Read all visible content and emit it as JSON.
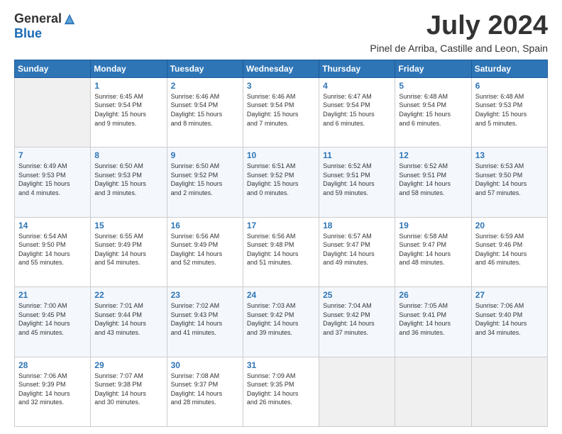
{
  "header": {
    "logo_general": "General",
    "logo_blue": "Blue",
    "month_title": "July 2024",
    "location": "Pinel de Arriba, Castille and Leon, Spain"
  },
  "calendar": {
    "days_of_week": [
      "Sunday",
      "Monday",
      "Tuesday",
      "Wednesday",
      "Thursday",
      "Friday",
      "Saturday"
    ],
    "weeks": [
      [
        {
          "day": "",
          "info": ""
        },
        {
          "day": "1",
          "info": "Sunrise: 6:45 AM\nSunset: 9:54 PM\nDaylight: 15 hours\nand 9 minutes."
        },
        {
          "day": "2",
          "info": "Sunrise: 6:46 AM\nSunset: 9:54 PM\nDaylight: 15 hours\nand 8 minutes."
        },
        {
          "day": "3",
          "info": "Sunrise: 6:46 AM\nSunset: 9:54 PM\nDaylight: 15 hours\nand 7 minutes."
        },
        {
          "day": "4",
          "info": "Sunrise: 6:47 AM\nSunset: 9:54 PM\nDaylight: 15 hours\nand 6 minutes."
        },
        {
          "day": "5",
          "info": "Sunrise: 6:48 AM\nSunset: 9:54 PM\nDaylight: 15 hours\nand 6 minutes."
        },
        {
          "day": "6",
          "info": "Sunrise: 6:48 AM\nSunset: 9:53 PM\nDaylight: 15 hours\nand 5 minutes."
        }
      ],
      [
        {
          "day": "7",
          "info": "Sunrise: 6:49 AM\nSunset: 9:53 PM\nDaylight: 15 hours\nand 4 minutes."
        },
        {
          "day": "8",
          "info": "Sunrise: 6:50 AM\nSunset: 9:53 PM\nDaylight: 15 hours\nand 3 minutes."
        },
        {
          "day": "9",
          "info": "Sunrise: 6:50 AM\nSunset: 9:52 PM\nDaylight: 15 hours\nand 2 minutes."
        },
        {
          "day": "10",
          "info": "Sunrise: 6:51 AM\nSunset: 9:52 PM\nDaylight: 15 hours\nand 0 minutes."
        },
        {
          "day": "11",
          "info": "Sunrise: 6:52 AM\nSunset: 9:51 PM\nDaylight: 14 hours\nand 59 minutes."
        },
        {
          "day": "12",
          "info": "Sunrise: 6:52 AM\nSunset: 9:51 PM\nDaylight: 14 hours\nand 58 minutes."
        },
        {
          "day": "13",
          "info": "Sunrise: 6:53 AM\nSunset: 9:50 PM\nDaylight: 14 hours\nand 57 minutes."
        }
      ],
      [
        {
          "day": "14",
          "info": "Sunrise: 6:54 AM\nSunset: 9:50 PM\nDaylight: 14 hours\nand 55 minutes."
        },
        {
          "day": "15",
          "info": "Sunrise: 6:55 AM\nSunset: 9:49 PM\nDaylight: 14 hours\nand 54 minutes."
        },
        {
          "day": "16",
          "info": "Sunrise: 6:56 AM\nSunset: 9:49 PM\nDaylight: 14 hours\nand 52 minutes."
        },
        {
          "day": "17",
          "info": "Sunrise: 6:56 AM\nSunset: 9:48 PM\nDaylight: 14 hours\nand 51 minutes."
        },
        {
          "day": "18",
          "info": "Sunrise: 6:57 AM\nSunset: 9:47 PM\nDaylight: 14 hours\nand 49 minutes."
        },
        {
          "day": "19",
          "info": "Sunrise: 6:58 AM\nSunset: 9:47 PM\nDaylight: 14 hours\nand 48 minutes."
        },
        {
          "day": "20",
          "info": "Sunrise: 6:59 AM\nSunset: 9:46 PM\nDaylight: 14 hours\nand 46 minutes."
        }
      ],
      [
        {
          "day": "21",
          "info": "Sunrise: 7:00 AM\nSunset: 9:45 PM\nDaylight: 14 hours\nand 45 minutes."
        },
        {
          "day": "22",
          "info": "Sunrise: 7:01 AM\nSunset: 9:44 PM\nDaylight: 14 hours\nand 43 minutes."
        },
        {
          "day": "23",
          "info": "Sunrise: 7:02 AM\nSunset: 9:43 PM\nDaylight: 14 hours\nand 41 minutes."
        },
        {
          "day": "24",
          "info": "Sunrise: 7:03 AM\nSunset: 9:42 PM\nDaylight: 14 hours\nand 39 minutes."
        },
        {
          "day": "25",
          "info": "Sunrise: 7:04 AM\nSunset: 9:42 PM\nDaylight: 14 hours\nand 37 minutes."
        },
        {
          "day": "26",
          "info": "Sunrise: 7:05 AM\nSunset: 9:41 PM\nDaylight: 14 hours\nand 36 minutes."
        },
        {
          "day": "27",
          "info": "Sunrise: 7:06 AM\nSunset: 9:40 PM\nDaylight: 14 hours\nand 34 minutes."
        }
      ],
      [
        {
          "day": "28",
          "info": "Sunrise: 7:06 AM\nSunset: 9:39 PM\nDaylight: 14 hours\nand 32 minutes."
        },
        {
          "day": "29",
          "info": "Sunrise: 7:07 AM\nSunset: 9:38 PM\nDaylight: 14 hours\nand 30 minutes."
        },
        {
          "day": "30",
          "info": "Sunrise: 7:08 AM\nSunset: 9:37 PM\nDaylight: 14 hours\nand 28 minutes."
        },
        {
          "day": "31",
          "info": "Sunrise: 7:09 AM\nSunset: 9:35 PM\nDaylight: 14 hours\nand 26 minutes."
        },
        {
          "day": "",
          "info": ""
        },
        {
          "day": "",
          "info": ""
        },
        {
          "day": "",
          "info": ""
        }
      ]
    ]
  }
}
